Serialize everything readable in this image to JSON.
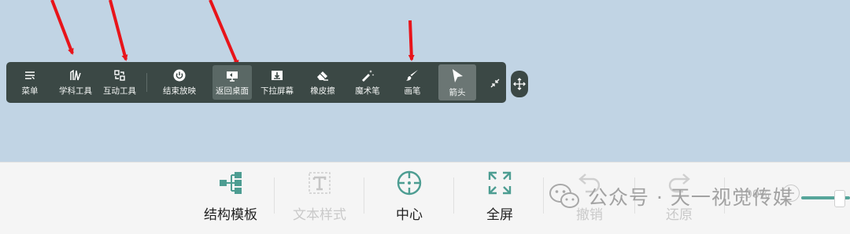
{
  "toolbar": {
    "items": [
      {
        "label": "菜单",
        "icon": "menu-icon"
      },
      {
        "label": "学科工具",
        "icon": "subject-tools-icon"
      },
      {
        "label": "互动工具",
        "icon": "interactive-tools-icon"
      },
      {
        "label": "结束放映",
        "icon": "power-icon"
      },
      {
        "label": "返回桌面",
        "icon": "desktop-icon"
      },
      {
        "label": "下拉屏幕",
        "icon": "pull-down-screen-icon"
      },
      {
        "label": "橡皮擦",
        "icon": "eraser-icon"
      },
      {
        "label": "魔术笔",
        "icon": "magic-pen-icon"
      },
      {
        "label": "画笔",
        "icon": "brush-icon"
      },
      {
        "label": "箭头",
        "icon": "cursor-arrow-icon"
      }
    ]
  },
  "bottombar": {
    "items": [
      {
        "label": "结构模板",
        "icon": "structure-template-icon",
        "disabled": false
      },
      {
        "label": "文本样式",
        "icon": "text-style-icon",
        "disabled": true
      },
      {
        "label": "中心",
        "icon": "center-icon",
        "disabled": false
      },
      {
        "label": "全屏",
        "icon": "fullscreen-icon",
        "disabled": false
      },
      {
        "label": "撤销",
        "icon": "undo-icon",
        "disabled": true
      },
      {
        "label": "还原",
        "icon": "redo-icon",
        "disabled": true
      }
    ],
    "zoom": "100%"
  },
  "watermark": "公众号 · 天一视觉传媒",
  "colors": {
    "canvas_bg": "#c1d4e4",
    "toolbar_bg": "#3b4845",
    "accent": "#56a59a",
    "arrow": "#e8141a"
  }
}
